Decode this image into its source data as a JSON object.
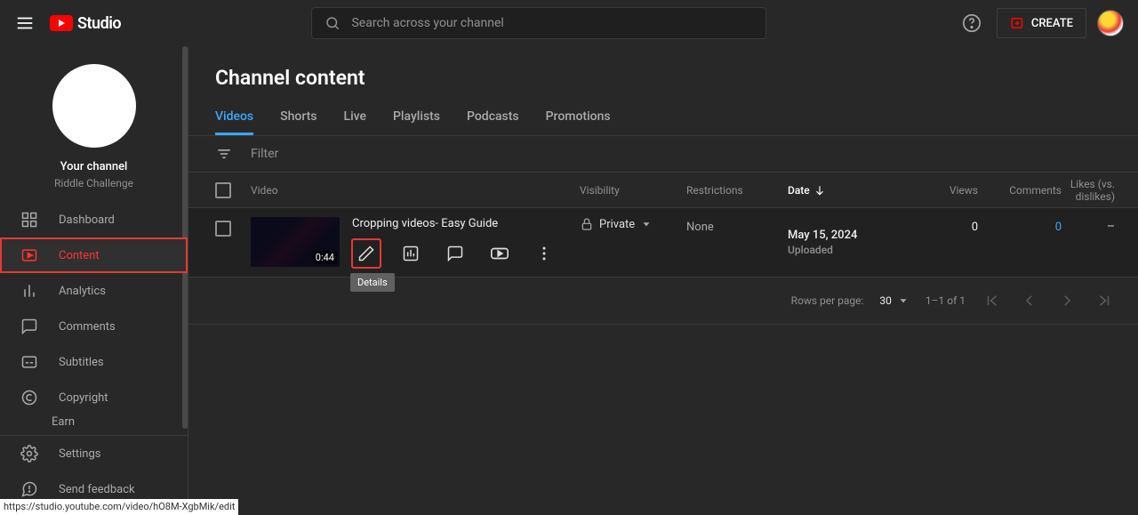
{
  "header": {
    "logo_text": "Studio",
    "search_placeholder": "Search across your channel",
    "create_label": "CREATE"
  },
  "channel": {
    "your_label": "Your channel",
    "name": "Riddle Challenge"
  },
  "sidebar": {
    "items": [
      {
        "label": "Dashboard"
      },
      {
        "label": "Content"
      },
      {
        "label": "Analytics"
      },
      {
        "label": "Comments"
      },
      {
        "label": "Subtitles"
      },
      {
        "label": "Copyright"
      },
      {
        "label": "Earn"
      },
      {
        "label": "Settings"
      },
      {
        "label": "Send feedback"
      }
    ]
  },
  "page": {
    "title": "Channel content",
    "filter_placeholder": "Filter"
  },
  "tabs": [
    "Videos",
    "Shorts",
    "Live",
    "Playlists",
    "Podcasts",
    "Promotions"
  ],
  "columns": {
    "video": "Video",
    "visibility": "Visibility",
    "restrictions": "Restrictions",
    "date": "Date",
    "views": "Views",
    "comments": "Comments",
    "likes": "Likes (vs. dislikes)"
  },
  "rows": [
    {
      "title": "Cropping videos- Easy Guide",
      "duration": "0:44",
      "visibility": "Private",
      "restrictions": "None",
      "date": "May 15, 2024",
      "date_sub": "Uploaded",
      "views": "0",
      "comments": "0",
      "likes": "–",
      "tooltip": "Details"
    }
  ],
  "pager": {
    "rows_label": "Rows per page:",
    "rows_value": "30",
    "range": "1–1 of 1"
  },
  "status_url": "https://studio.youtube.com/video/hO8M-XgbMik/edit"
}
